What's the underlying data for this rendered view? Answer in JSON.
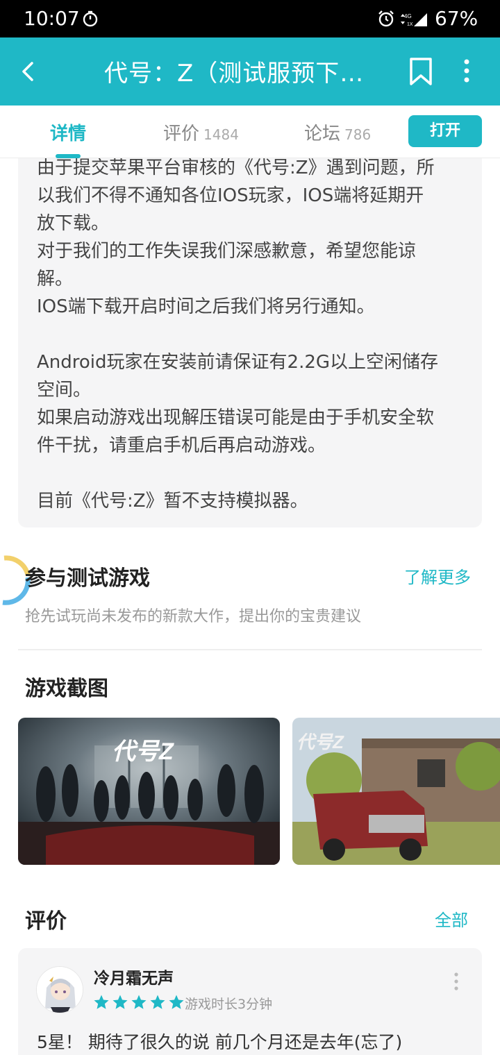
{
  "status_bar": {
    "time": "10:07",
    "battery": "67%",
    "network": "4G",
    "icons": [
      "timer-icon",
      "alarm-icon",
      "signal-icon"
    ]
  },
  "app_bar": {
    "title": "代号：Z（测试服预下…",
    "icons": [
      "back-icon",
      "bookmark-icon",
      "more-vertical-icon"
    ],
    "color": "#1fb8c6"
  },
  "tabs": [
    {
      "label": "详情",
      "count": ""
    },
    {
      "label": "评价",
      "count": "1484"
    },
    {
      "label": "论坛",
      "count": "786"
    }
  ],
  "open_button": "打开",
  "description": {
    "lines": [
      "由于提交苹果平台审核的《代号:Z》遇到问题，所",
      "以我们不得不通知各位IOS玩家，IOS端将延期开",
      "放下载。",
      "对于我们的工作失误我们深感歉意，希望您能谅",
      "解。",
      "IOS端下载开启时间之后我们将另行通知。",
      "",
      "Android玩家在安装前请保证有2.2G以上空闲储存",
      "空间。",
      "如果启动游戏出现解压错误可能是由于手机安全软",
      "件干扰，请重启手机后再启动游戏。",
      "",
      "目前《代号:Z》暂不支持模拟器。"
    ]
  },
  "beta_section": {
    "title": "参与测试游戏",
    "link": "了解更多",
    "subtitle": "抢先试玩尚未发布的新款大作，提出你的宝贵建议"
  },
  "screenshots_section": {
    "title": "游戏截图",
    "logo_text": "代号Z"
  },
  "reviews_section": {
    "title": "评价",
    "link": "全部",
    "review": {
      "name": "冷月霜无声",
      "rating": 5,
      "playtime": "游戏时长3分钟",
      "text": "5星！ 期待了很久的说 前几个月还是去年(忘了)"
    }
  }
}
